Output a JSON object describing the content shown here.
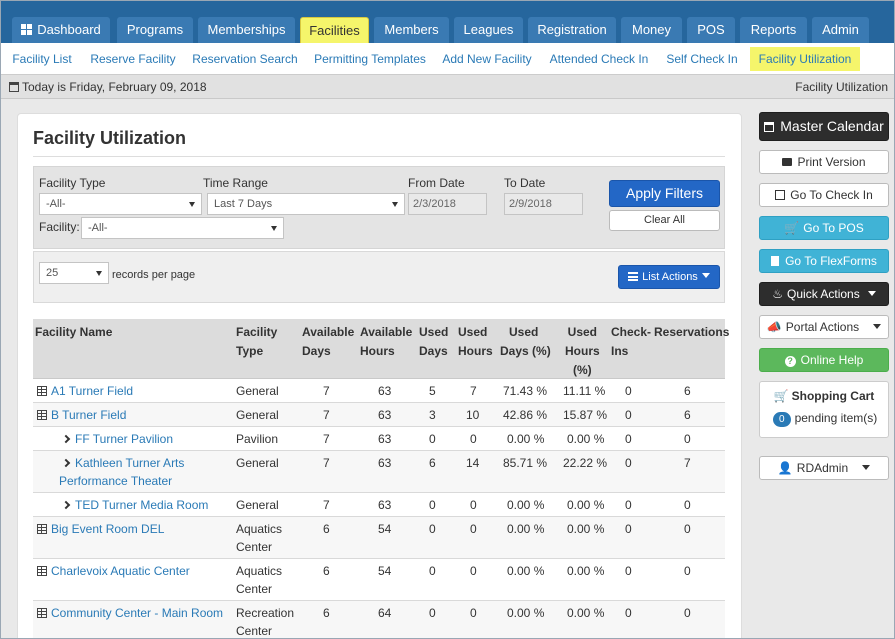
{
  "nav": {
    "tabs": [
      "Dashboard",
      "Programs",
      "Memberships",
      "Facilities",
      "Members",
      "Leagues",
      "Registration",
      "Money",
      "POS",
      "Reports",
      "Admin"
    ],
    "active_tab": "Facilities",
    "active_color": "#f5f56b",
    "bar_color": "#26669d"
  },
  "subnav": {
    "items": [
      "Facility List",
      "Reserve Facility",
      "Reservation Search",
      "Permitting Templates",
      "Add New Facility",
      "Attended Check In",
      "Self Check In",
      "Facility Utilization"
    ],
    "active_item": "Facility Utilization"
  },
  "datebar": {
    "today": "Today is Friday, February 09, 2018",
    "page": "Facility Utilization"
  },
  "page_title": "Facility Utilization",
  "filters": {
    "facility_type_label": "Facility Type",
    "facility_type_value": "-All-",
    "time_range_label": "Time Range",
    "time_range_value": "Last 7 Days",
    "from_date_label": "From Date",
    "from_date_value": "2/3/2018",
    "to_date_label": "To Date",
    "to_date_value": "2/9/2018",
    "facility_label": "Facility:",
    "facility_value": "-All-",
    "apply_label": "Apply Filters",
    "clear_label": "Clear All"
  },
  "records": {
    "per_page_value": "25",
    "per_page_label": "records per page",
    "list_actions_label": "List Actions"
  },
  "table": {
    "headers": {
      "name": "Facility Name",
      "type_1": "Facility",
      "type_2": "Type",
      "avail_days_1": "Available",
      "avail_days_2": "Days",
      "avail_hours_1": "Available",
      "avail_hours_2": "Hours",
      "used_days_1": "Used",
      "used_days_2": "Days",
      "used_hours_1": "Used",
      "used_hours_2": "Hours",
      "used_days_pct_1": "Used",
      "used_days_pct_2": "Days (%)",
      "used_hours_pct_1": "Used",
      "used_hours_pct_2": "Hours",
      "used_hours_pct_3": "(%)",
      "checkins_1": "Check-",
      "checkins_2": "Ins",
      "reservations": "Reservations"
    },
    "rows": [
      {
        "name": "A1 Turner Field",
        "type": "General",
        "avail_days": "7",
        "avail_hours": "63",
        "used_days": "5",
        "used_hours": "7",
        "used_days_pct": "71.43 %",
        "used_hours_pct": "11.11 %",
        "checkins": "0",
        "reservations": "6"
      },
      {
        "name": "B Turner Field",
        "type": "General",
        "avail_days": "7",
        "avail_hours": "63",
        "used_days": "3",
        "used_hours": "10",
        "used_days_pct": "42.86 %",
        "used_hours_pct": "15.87 %",
        "checkins": "0",
        "reservations": "6"
      },
      {
        "name": "FF Turner Pavilion",
        "type": "Pavilion",
        "avail_days": "7",
        "avail_hours": "63",
        "used_days": "0",
        "used_hours": "0",
        "used_days_pct": "0.00 %",
        "used_hours_pct": "0.00 %",
        "checkins": "0",
        "reservations": "0"
      },
      {
        "name_1": "Kathleen Turner Arts",
        "name_2": "Performance Theater",
        "type": "General",
        "avail_days": "7",
        "avail_hours": "63",
        "used_days": "6",
        "used_hours": "14",
        "used_days_pct": "85.71 %",
        "used_hours_pct": "22.22 %",
        "checkins": "0",
        "reservations": "7"
      },
      {
        "name": "TED Turner Media Room",
        "type": "General",
        "avail_days": "7",
        "avail_hours": "63",
        "used_days": "0",
        "used_hours": "0",
        "used_days_pct": "0.00 %",
        "used_hours_pct": "0.00 %",
        "checkins": "0",
        "reservations": "0"
      },
      {
        "name": "Big Event Room DEL",
        "type_1": "Aquatics",
        "type_2": "Center",
        "avail_days": "6",
        "avail_hours": "54",
        "used_days": "0",
        "used_hours": "0",
        "used_days_pct": "0.00 %",
        "used_hours_pct": "0.00 %",
        "checkins": "0",
        "reservations": "0"
      },
      {
        "name": "Charlevoix Aquatic Center",
        "type_1": "Aquatics",
        "type_2": "Center",
        "avail_days": "6",
        "avail_hours": "54",
        "used_days": "0",
        "used_hours": "0",
        "used_days_pct": "0.00 %",
        "used_hours_pct": "0.00 %",
        "checkins": "0",
        "reservations": "0"
      },
      {
        "name": "Community Center - Main Room",
        "type_1": "Recreation",
        "type_2": "Center",
        "avail_days": "6",
        "avail_hours": "64",
        "used_days": "0",
        "used_hours": "0",
        "used_days_pct": "0.00 %",
        "used_hours_pct": "0.00 %",
        "checkins": "0",
        "reservations": "0"
      }
    ]
  },
  "sidebar": {
    "master_calendar": "Master Calendar",
    "print_version": "Print Version",
    "go_to_check_in": "Go To Check In",
    "go_to_pos": "Go To POS",
    "go_to_flexforms": "Go To FlexForms",
    "quick_actions": "Quick Actions",
    "portal_actions": "Portal Actions",
    "online_help": "Online Help",
    "cart_title": "Shopping Cart",
    "cart_count": "0",
    "cart_pending": "pending item(s)",
    "user": "RDAdmin"
  }
}
